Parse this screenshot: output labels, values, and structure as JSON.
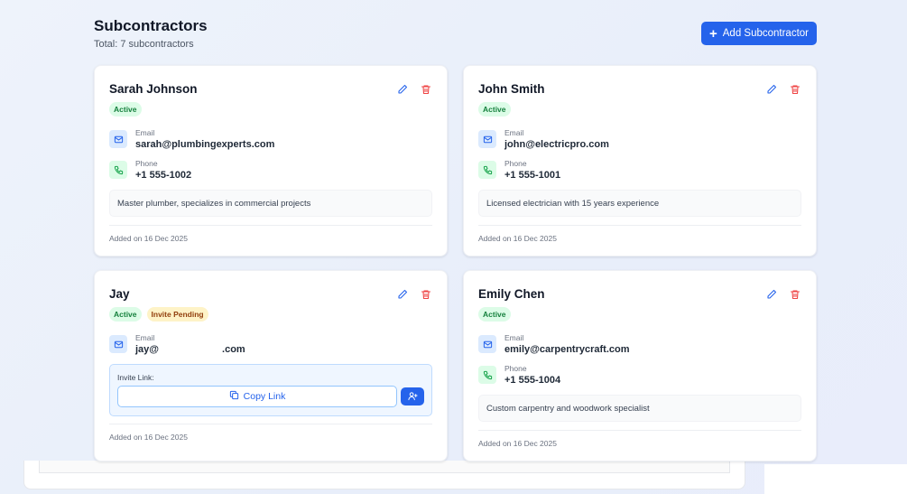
{
  "header": {
    "title": "Subcontractors",
    "subtitle": "Total: 7 subcontractors",
    "add_button_label": "Add Subcontractor"
  },
  "labels": {
    "email": "Email",
    "phone": "Phone",
    "invite_link": "Invite Link:",
    "copy_link": "Copy Link"
  },
  "colors": {
    "accent": "#2563eb",
    "active_badge_bg": "#dcfce7",
    "active_badge_text": "#15803d",
    "pending_badge_bg": "#fef3c7",
    "pending_badge_text": "#92400e",
    "delete_icon": "#ef4444"
  },
  "cards": [
    {
      "name": "Sarah Johnson",
      "badges": [
        "Active"
      ],
      "email": "sarah@plumbingexperts.com",
      "phone": "+1 555-1002",
      "notes": "Master plumber, specializes in commercial projects",
      "added": "Added on 16 Dec 2025"
    },
    {
      "name": "John Smith",
      "badges": [
        "Active"
      ],
      "email": "john@electricpro.com",
      "phone": "+1 555-1001",
      "notes": "Licensed electrician with 15 years experience",
      "added": "Added on 16 Dec 2025"
    },
    {
      "name": "Jay",
      "badges": [
        "Active",
        "Invite Pending"
      ],
      "email_prefix": "jay@",
      "email_suffix": ".com",
      "added": "Added on 16 Dec 2025"
    },
    {
      "name": "Emily Chen",
      "badges": [
        "Active"
      ],
      "email": "emily@carpentrycraft.com",
      "phone": "+1 555-1004",
      "notes": "Custom carpentry and woodwork specialist",
      "added": "Added on 16 Dec 2025"
    }
  ],
  "icons": {
    "edit": "pencil-icon",
    "delete": "trash-icon",
    "email": "mail-icon",
    "phone": "phone-icon",
    "copy": "copy-icon",
    "resend": "user-plus-icon",
    "add": "plus-icon"
  }
}
